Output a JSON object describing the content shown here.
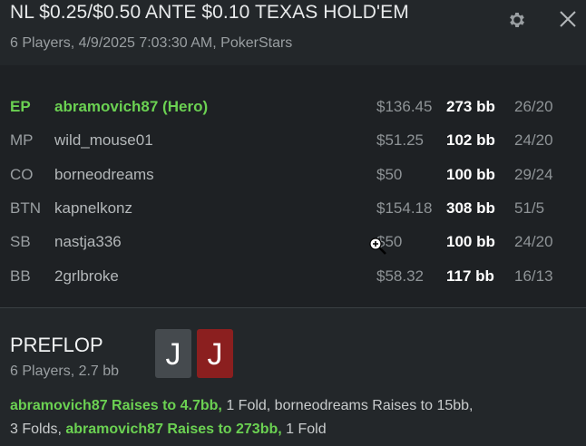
{
  "header": {
    "title": "NL $0.25/$0.50 ANTE $0.10 TEXAS HOLD'EM",
    "subtitle": "6 Players, 4/9/2025 7:03:30 AM, PokerStars",
    "settings_icon": "gear-icon",
    "close_icon": "close-icon"
  },
  "players": [
    {
      "position": "EP",
      "name": "abramovich87 (Hero)",
      "stack": "$136.45",
      "bb": "273 bb",
      "stats": "26/20",
      "hero": true
    },
    {
      "position": "MP",
      "name": "wild_mouse01",
      "stack": "$51.25",
      "bb": "102 bb",
      "stats": "24/20"
    },
    {
      "position": "CO",
      "name": "borneodreams",
      "stack": "$50",
      "bb": "100 bb",
      "stats": "29/24"
    },
    {
      "position": "BTN",
      "name": "kapnelkonz",
      "stack": "$154.18",
      "bb": "308 bb",
      "stats": "51/5"
    },
    {
      "position": "SB",
      "name": "nastja336",
      "stack": "$50",
      "bb": "100 bb",
      "stats": "24/20"
    },
    {
      "position": "BB",
      "name": "2grlbroke",
      "stack": "$58.32",
      "bb": "117 bb",
      "stats": "16/13"
    }
  ],
  "street": {
    "title": "PREFLOP",
    "subtitle": "6 Players, 2.7 bb",
    "cards": [
      {
        "rank": "J",
        "suit_color": "#454a4e"
      },
      {
        "rank": "J",
        "suit_color": "#8b1f1f"
      }
    ],
    "actions_line1": [
      {
        "text": "abramovich87 Raises to 4.7bb,",
        "hero": true
      },
      {
        "text": " 1 Fold, borneodreams Raises to 15bb,",
        "hero": false
      }
    ],
    "actions_line2": [
      {
        "text": "3 Folds, ",
        "hero": false
      },
      {
        "text": "abramovich87 Raises to 273bb,",
        "hero": true
      },
      {
        "text": " 1 Fold",
        "hero": false
      }
    ]
  },
  "colors": {
    "hero_green": "#6bd152",
    "background": "#23272a",
    "panel": "#1e2124"
  }
}
